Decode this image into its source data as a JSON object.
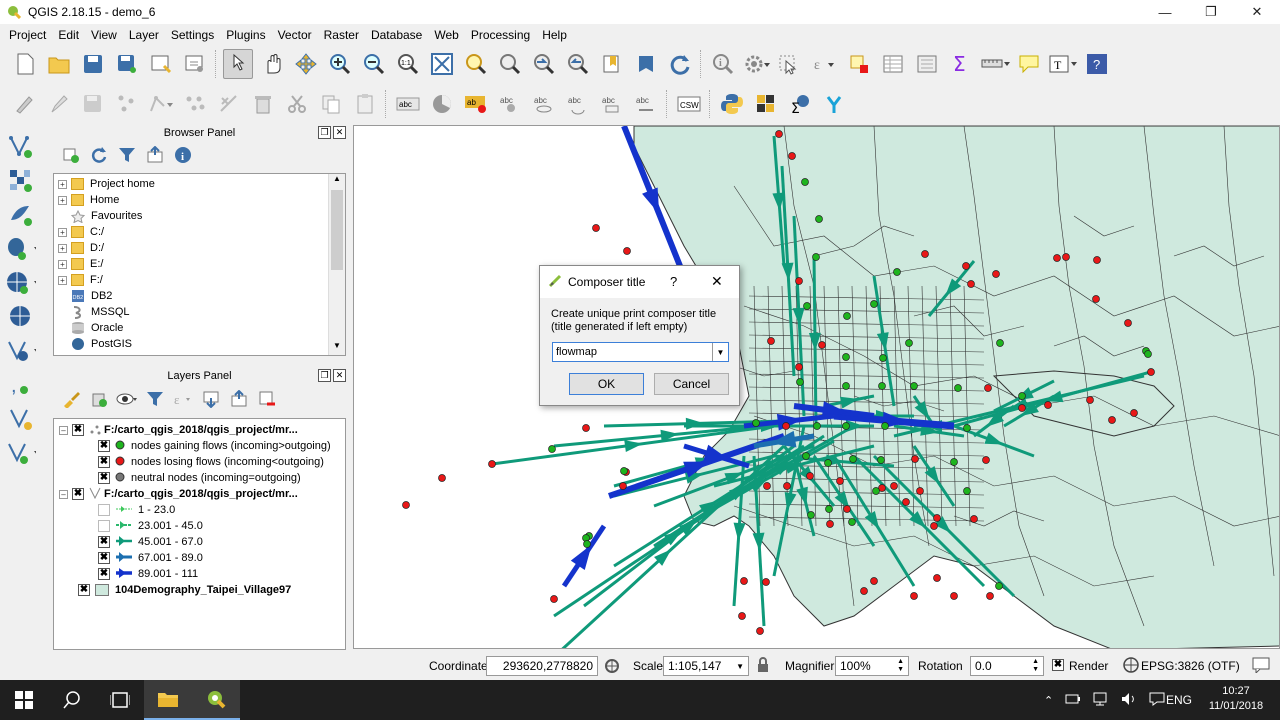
{
  "window": {
    "title": "QGIS 2.18.15 - demo_6"
  },
  "menu": [
    "Project",
    "Edit",
    "View",
    "Layer",
    "Settings",
    "Plugins",
    "Vector",
    "Raster",
    "Database",
    "Web",
    "Processing",
    "Help"
  ],
  "browser_panel": {
    "title": "Browser Panel",
    "items": [
      {
        "label": "Project home",
        "icon": "folder-icon",
        "expandable": true
      },
      {
        "label": "Home",
        "icon": "folder-icon",
        "expandable": true
      },
      {
        "label": "Favourites",
        "icon": "star-icon",
        "expandable": false
      },
      {
        "label": "C:/",
        "icon": "folder-icon",
        "expandable": true
      },
      {
        "label": "D:/",
        "icon": "folder-icon",
        "expandable": true
      },
      {
        "label": "E:/",
        "icon": "folder-icon",
        "expandable": true
      },
      {
        "label": "F:/",
        "icon": "folder-icon",
        "expandable": true
      },
      {
        "label": "DB2",
        "icon": "db2-icon",
        "expandable": false
      },
      {
        "label": "MSSQL",
        "icon": "mssql-icon",
        "expandable": false
      },
      {
        "label": "Oracle",
        "icon": "oracle-icon",
        "expandable": false
      },
      {
        "label": "PostGIS",
        "icon": "postgis-icon",
        "expandable": false
      }
    ]
  },
  "layers_panel": {
    "title": "Layers Panel",
    "layers": [
      {
        "name": "F:/carto_qgis_2018/qgis_project/mr...",
        "checked": true,
        "classes": [
          {
            "label": "nodes gaining flows (incoming>outgoing)",
            "checked": true,
            "color": "#1eb41e"
          },
          {
            "label": "nodes losing flows (incoming<outgoing)",
            "checked": true,
            "color": "#e81818"
          },
          {
            "label": "neutral nodes (incoming=outgoing)",
            "checked": true,
            "color": "#777777"
          }
        ]
      },
      {
        "name": "F:/carto_qgis_2018/qgis_project/mr...",
        "checked": true,
        "classes": [
          {
            "label": "1 - 23.0",
            "checked": false,
            "color": "#3cc85a"
          },
          {
            "label": "23.001 - 45.0",
            "checked": false,
            "color": "#2ab86c"
          },
          {
            "label": "45.001 - 67.0",
            "checked": true,
            "color": "#0f9a7a"
          },
          {
            "label": "67.001 - 89.0",
            "checked": true,
            "color": "#1c6fb0"
          },
          {
            "label": "89.001 - 111",
            "checked": true,
            "color": "#1433cc"
          }
        ]
      },
      {
        "name": "104Demography_Taipei_Village97",
        "checked": true,
        "color": "#cfe9de"
      }
    ]
  },
  "dialog": {
    "title": "Composer title",
    "help": "?",
    "close": "✕",
    "prompt_line1": "Create unique print composer title",
    "prompt_line2": "(title generated if left empty)",
    "input_value": "flowmap",
    "ok": "OK",
    "cancel": "Cancel"
  },
  "status": {
    "coordinate_label": "Coordinate",
    "coordinate": "293620,2778820",
    "scale_label": "Scale",
    "scale": "1:105,147",
    "magnifier_label": "Magnifier",
    "magnifier": "100%",
    "rotation_label": "Rotation",
    "rotation": "0.0",
    "render_label": "Render",
    "crs": "EPSG:3826 (OTF)"
  },
  "taskbar": {
    "lang": "ENG",
    "time": "10:27",
    "date": "11/01/2018"
  },
  "colors": {
    "map_fill": "#cfe9de",
    "map_border": "#333",
    "flow_green": "#0f9a7a",
    "flow_blue": "#1433cc",
    "node_green": "#1eb41e",
    "node_red": "#e81818"
  }
}
